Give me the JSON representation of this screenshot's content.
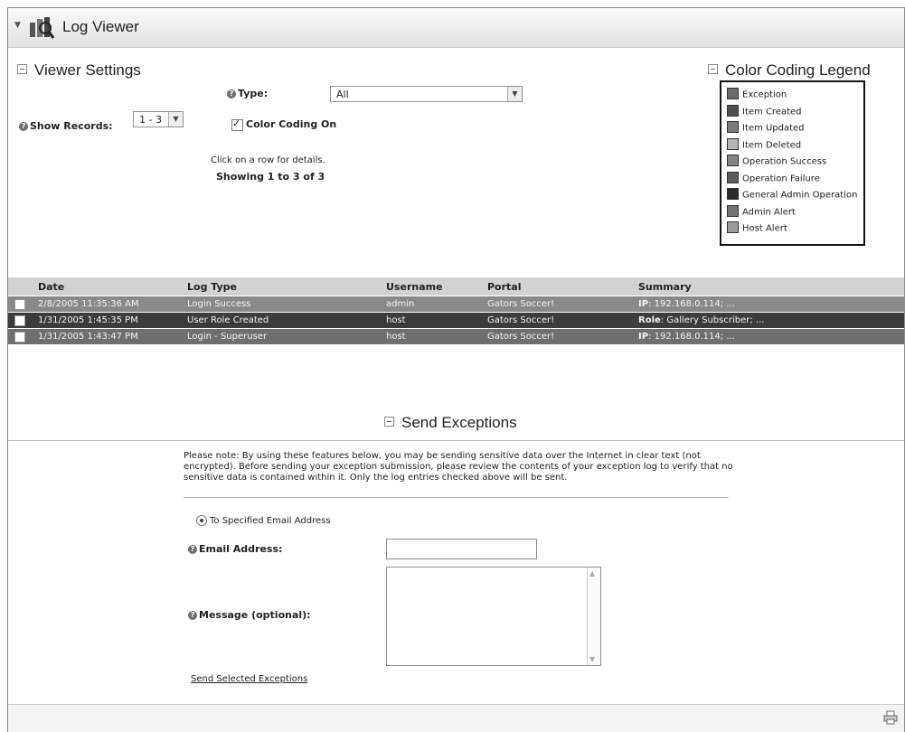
{
  "header": {
    "title": "Log Viewer",
    "icon": "log-viewer-icon"
  },
  "viewer_settings": {
    "heading": "Viewer Settings",
    "type_label": "Type:",
    "type_value": "All",
    "show_records_label": "Show Records:",
    "show_records_value": "1 - 3",
    "color_coding_label": "Color Coding On",
    "color_coding_checked": true,
    "click_hint": "Click on a row for details.",
    "showing": "Showing 1 to 3 of 3"
  },
  "legend": {
    "heading": "Color Coding Legend",
    "items": [
      {
        "label": "Exception",
        "color": "#6b6b6b"
      },
      {
        "label": "Item Created",
        "color": "#505050"
      },
      {
        "label": "Item Updated",
        "color": "#7a7a7a"
      },
      {
        "label": "Item Deleted",
        "color": "#b5b5b5"
      },
      {
        "label": "Operation Success",
        "color": "#858585"
      },
      {
        "label": "Operation Failure",
        "color": "#5c5c5c"
      },
      {
        "label": "General Admin Operation",
        "color": "#2a2a2a"
      },
      {
        "label": "Admin Alert",
        "color": "#737373"
      },
      {
        "label": "Host Alert",
        "color": "#9a9a9a"
      }
    ]
  },
  "log_table": {
    "columns": [
      "Date",
      "Log Type",
      "Username",
      "Portal",
      "Summary"
    ],
    "rows": [
      {
        "date": "2/8/2005 11:35:36 AM",
        "log_type": "Login Success",
        "username": "admin",
        "portal": "Gators Soccer!",
        "summary_key": "IP",
        "summary_value": ": 192.168.0.114; ...",
        "color": "#8a8a8a"
      },
      {
        "date": "1/31/2005 1:45:35 PM",
        "log_type": "User Role Created",
        "username": "host",
        "portal": "Gators Soccer!",
        "summary_key": "Role",
        "summary_value": ": Gallery Subscriber; ...",
        "color": "#3c3c3c"
      },
      {
        "date": "1/31/2005 1:43:47 PM",
        "log_type": "Login - Superuser",
        "username": "host",
        "portal": "Gators Soccer!",
        "summary_key": "IP",
        "summary_value": ": 192.168.0.114; ...",
        "color": "#6f6f6f"
      }
    ]
  },
  "send_exceptions": {
    "heading": "Send Exceptions",
    "note": "Please note: By using these features below, you may be sending sensitive data over the Internet in clear text (not encrypted). Before sending your exception submission, please review the contents of your exception log to verify that no sensitive data is contained within it. Only the log entries checked above will be sent.",
    "radio_label": "To Specified Email Address",
    "email_label": "Email Address:",
    "email_value": "",
    "message_label": "Message (optional):",
    "message_value": "",
    "send_link": "Send Selected Exceptions"
  },
  "footer": {
    "icon": "print-icon"
  }
}
